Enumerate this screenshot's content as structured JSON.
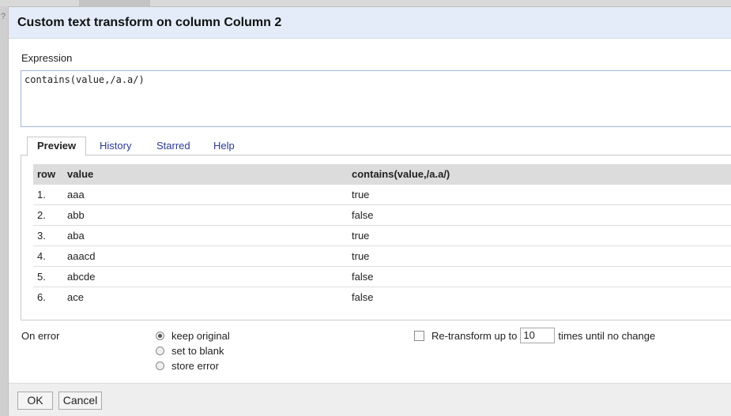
{
  "dialog": {
    "title": "Custom text transform on column Column 2"
  },
  "expression": {
    "label": "Expression",
    "value": "contains(value,/a.a/)"
  },
  "tabs": [
    {
      "label": "Preview",
      "active": true
    },
    {
      "label": "History",
      "active": false
    },
    {
      "label": "Starred",
      "active": false
    },
    {
      "label": "Help",
      "active": false
    }
  ],
  "preview": {
    "headers": [
      "row",
      "value",
      "contains(value,/a.a/)"
    ],
    "rows": [
      {
        "row": "1.",
        "value": "aaa",
        "result": "true"
      },
      {
        "row": "2.",
        "value": "abb",
        "result": "false"
      },
      {
        "row": "3.",
        "value": "aba",
        "result": "true"
      },
      {
        "row": "4.",
        "value": "aaacd",
        "result": "true"
      },
      {
        "row": "5.",
        "value": "abcde",
        "result": "false"
      },
      {
        "row": "6.",
        "value": "ace",
        "result": "false"
      }
    ]
  },
  "on_error": {
    "label": "On error",
    "options": [
      {
        "label": "keep original",
        "checked": true
      },
      {
        "label": "set to blank",
        "checked": false
      },
      {
        "label": "store error",
        "checked": false
      }
    ]
  },
  "retransform": {
    "checked": false,
    "label_before": "Re-transform up to",
    "value": "10",
    "label_after": "times until no change"
  },
  "buttons": {
    "ok": "OK",
    "cancel": "Cancel"
  },
  "colors": {
    "header_bg": "#e3ecf8",
    "link": "#2a3a9a",
    "table_header_bg": "#dcdcdc"
  }
}
